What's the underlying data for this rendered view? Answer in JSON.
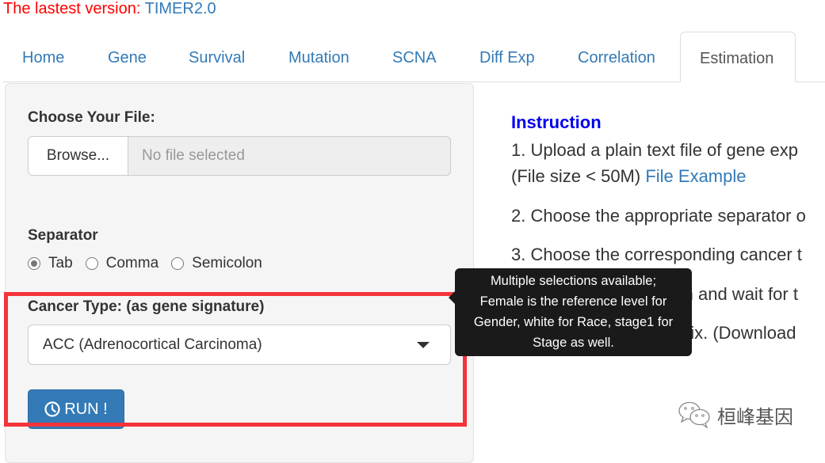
{
  "banner": {
    "prefix": "The lastest version: ",
    "link": "TIMER2.0"
  },
  "tabs": [
    {
      "label": "Home"
    },
    {
      "label": "Gene"
    },
    {
      "label": "Survival"
    },
    {
      "label": "Mutation"
    },
    {
      "label": "SCNA"
    },
    {
      "label": "Diff Exp"
    },
    {
      "label": "Correlation"
    },
    {
      "label": "Estimation",
      "active": true
    }
  ],
  "form": {
    "file_label": "Choose Your File:",
    "browse_label": "Browse...",
    "file_placeholder": "No file selected",
    "separator_label": "Separator",
    "separator_options": [
      {
        "label": "Tab",
        "checked": true
      },
      {
        "label": "Comma",
        "checked": false
      },
      {
        "label": "Semicolon",
        "checked": false
      }
    ],
    "cancer_label": "Cancer Type: (as gene signature)",
    "cancer_selected": "ACC (Adrenocortical Carcinoma)",
    "run_label": "RUN !"
  },
  "instructions": {
    "title": "Instruction",
    "step1a": "1. Upload a plain text file of gene exp",
    "step1b": "(File size < 50M) ",
    "step1_link": "File Example",
    "step2": "2. Choose the appropriate separator o",
    "step3": "3. Choose the corresponding cancer t",
    "step4": "4. Click the RUN button and wait for t",
    "step5": "5. Download table matrix. (Download"
  },
  "tooltip": {
    "lines": [
      "Multiple selections available;",
      "Female is the reference level for",
      "Gender, white for Race, stage1 for",
      "Stage as well."
    ]
  },
  "watermark": {
    "text": "桓峰基因"
  },
  "colors": {
    "accent": "#337ab7",
    "highlight": "#f5333a",
    "banner": "#ff0000",
    "instruction_title": "#0000ee"
  }
}
